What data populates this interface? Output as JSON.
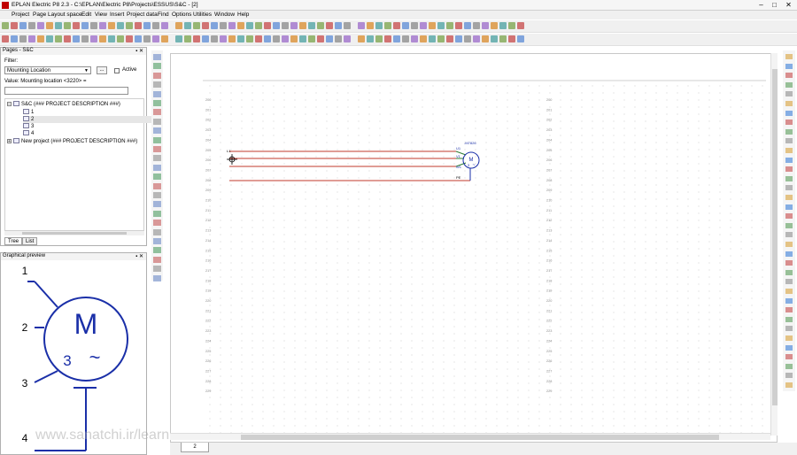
{
  "window": {
    "title": "EPLAN Electric P8 2.3 - C:\\EPLAN\\Electric P8\\Projects\\ESSUS\\S&C - [2]",
    "min": "–",
    "max": "□",
    "close": "✕"
  },
  "menu": {
    "items": [
      "Project",
      "Page",
      "Layout space",
      "Edit",
      "View",
      "Insert",
      "Project data",
      "Find",
      "Options",
      "Utilities",
      "Window",
      "Help"
    ],
    "mdi_min": "–",
    "mdi_restore": "▫",
    "mdi_close": "✕"
  },
  "pages_panel": {
    "title": "Pages - S&C",
    "pin": "▪ ✕",
    "filter_label": "Filter:",
    "filter_value": "Mounting Location",
    "filter_button": "...",
    "active_label": "Active",
    "value_label": "Value: Mounting location <3220> =",
    "tree": [
      {
        "label": "S&C (### PROJECT DESCRIPTION ###)",
        "level": 0,
        "expanded": true,
        "selected": false
      },
      {
        "label": "1",
        "level": 1,
        "selected": false
      },
      {
        "label": "2",
        "level": 1,
        "selected": true
      },
      {
        "label": "3",
        "level": 1,
        "selected": false
      },
      {
        "label": "4",
        "level": 1,
        "selected": false
      },
      {
        "label": "New project (### PROJECT DESCRIPTION ###)",
        "level": 0,
        "expanded": false,
        "selected": false
      }
    ],
    "tabs": [
      "Tree",
      "List"
    ]
  },
  "preview_panel": {
    "title": "Graphical preview",
    "pin": "▪ ✕",
    "symbol_letter": "M",
    "symbol_phase": "3",
    "symbol_tilde": "~",
    "pins": [
      "1",
      "2",
      "3",
      "4"
    ]
  },
  "watermark": "www.sanatchi.ir/learning",
  "canvas": {
    "row_numbers_left": [
      "200",
      "201",
      "202",
      "203",
      "204",
      "205",
      "206",
      "207",
      "208",
      "209",
      "210",
      "211",
      "212",
      "213",
      "214",
      "215",
      "216",
      "217",
      "218",
      "219",
      "220",
      "221",
      "222",
      "223",
      "224",
      "225",
      "226",
      "227",
      "228",
      "229"
    ],
    "row_numbers_right": [
      "200",
      "201",
      "202",
      "203",
      "204",
      "205",
      "206",
      "207",
      "208",
      "209",
      "210",
      "211",
      "212",
      "213",
      "214",
      "215",
      "216",
      "217",
      "218",
      "219",
      "220",
      "221",
      "222",
      "223",
      "224",
      "225",
      "226",
      "227",
      "228",
      "229"
    ],
    "motor": {
      "tag": "-M7826",
      "letter": "M",
      "phase": "3",
      "tilde": "~",
      "connection_labels": [
        "U1",
        "V1",
        "W1",
        "PE"
      ],
      "wire_label_left": "L1"
    },
    "wire_color": "#c0392b",
    "pe_color": "#2e7d32"
  },
  "page_tab": {
    "label": "2"
  },
  "colors": {
    "symbol_blue": "#1a2fa8",
    "app_red": "#c00000"
  }
}
